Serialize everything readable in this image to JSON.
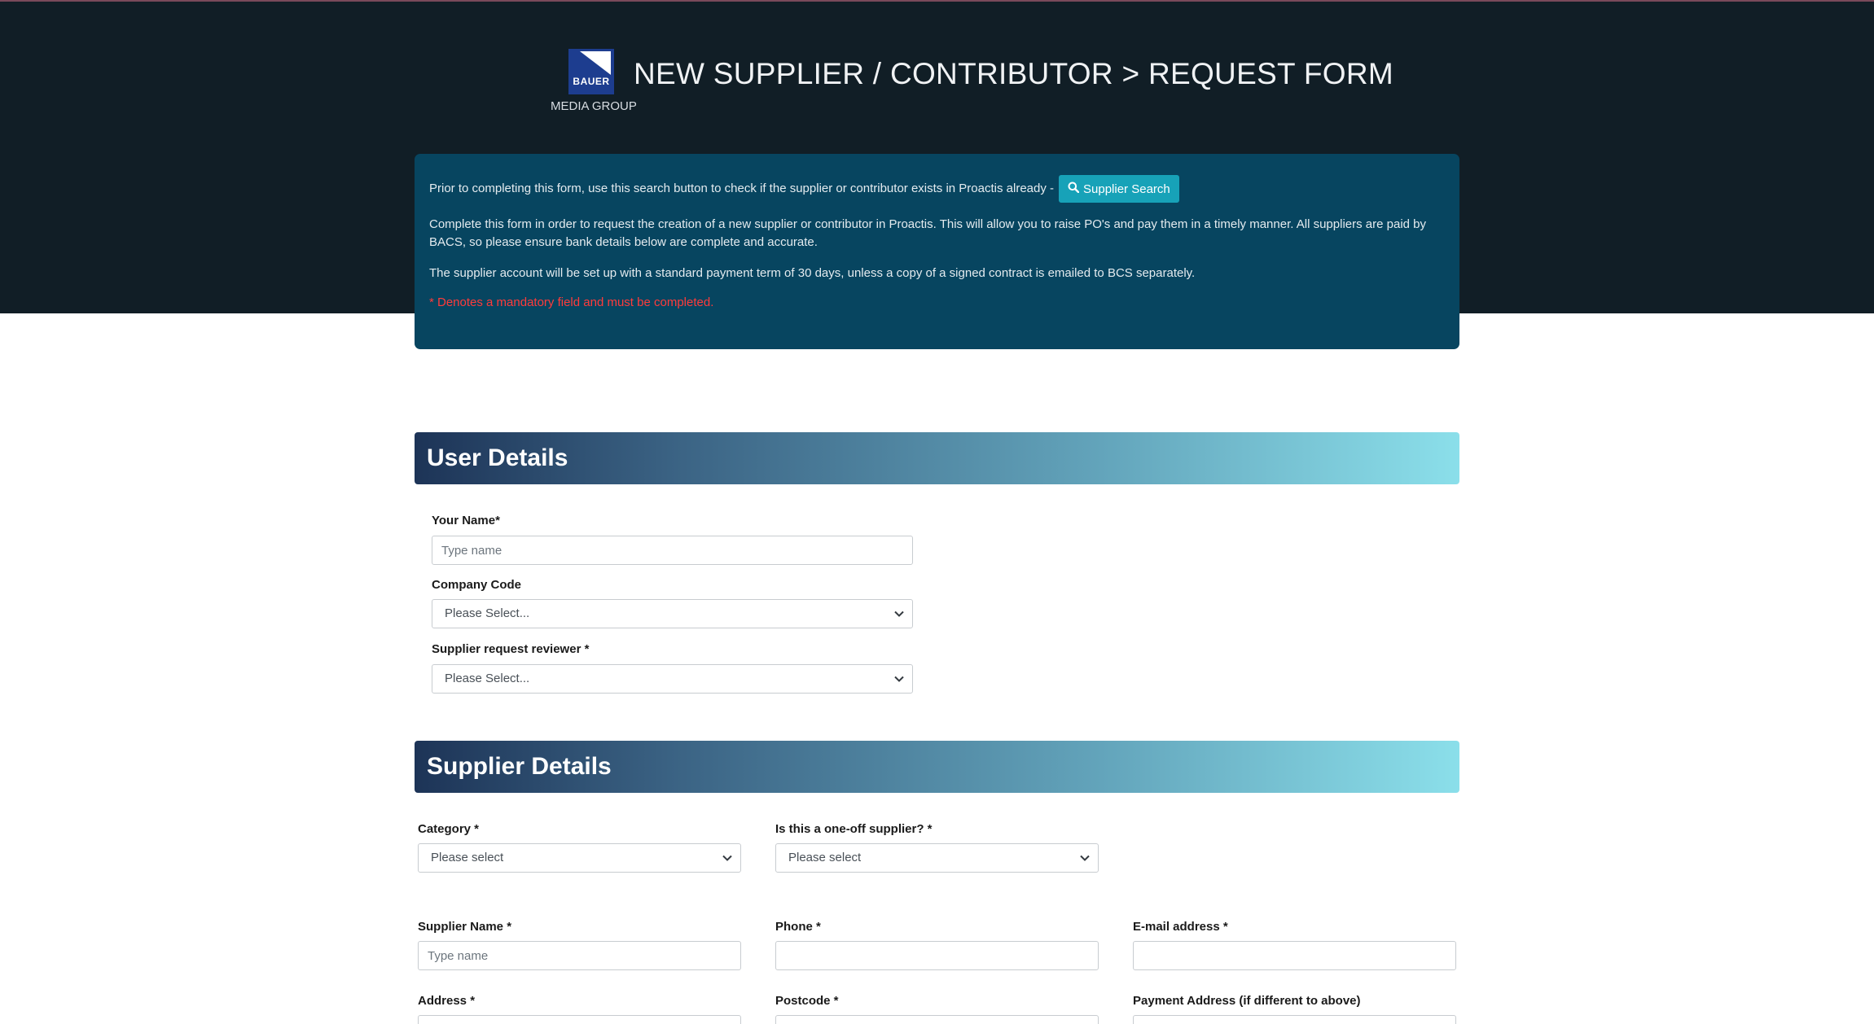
{
  "header": {
    "logo_text": "BAUER",
    "logo_subtitle": "MEDIA GROUP",
    "title": "NEW SUPPLIER / CONTRIBUTOR > REQUEST FORM"
  },
  "info": {
    "search_prompt": "Prior to completing this form, use this search button to check if the supplier or contributor exists in Proactis already -",
    "search_button": "Supplier Search",
    "paragraph": "Complete this form in order to request the creation of a new supplier or contributor in Proactis. This will allow you to raise PO's and pay them in a timely manner. All suppliers are paid by BACS, so please ensure bank details below are complete and accurate.",
    "payment_terms": "The supplier account will be set up with a standard payment term of 30 days, unless a copy of a signed contract is emailed to BCS separately.",
    "mandatory_note": "* Denotes a mandatory field and must be completed."
  },
  "user_details": {
    "heading": "User Details",
    "your_name_label": "Your Name*",
    "your_name_placeholder": "Type name",
    "company_code_label": "Company Code",
    "company_code_value": "Please Select...",
    "reviewer_label": "Supplier request reviewer *",
    "reviewer_value": "Please Select..."
  },
  "supplier_details": {
    "heading": "Supplier Details",
    "category_label": "Category *",
    "category_value": "Please select",
    "one_off_label": "Is this a one-off supplier? *",
    "one_off_value": "Please select",
    "supplier_name_label": "Supplier Name *",
    "supplier_name_placeholder": "Type name",
    "phone_label": "Phone *",
    "phone_value": "",
    "email_label": "E-mail address *",
    "email_value": "",
    "address_label": "Address *",
    "postcode_label": "Postcode *",
    "payment_address_label": "Payment Address (if different to above)"
  },
  "colors": {
    "header_bg": "#111e26",
    "panel_bg": "#074560",
    "button_bg": "#17a2b8",
    "mandatory_text": "#ff3b3b"
  },
  "icons": {
    "search_button_icon": "search-icon",
    "select_icon": "chevron-down-icon"
  }
}
